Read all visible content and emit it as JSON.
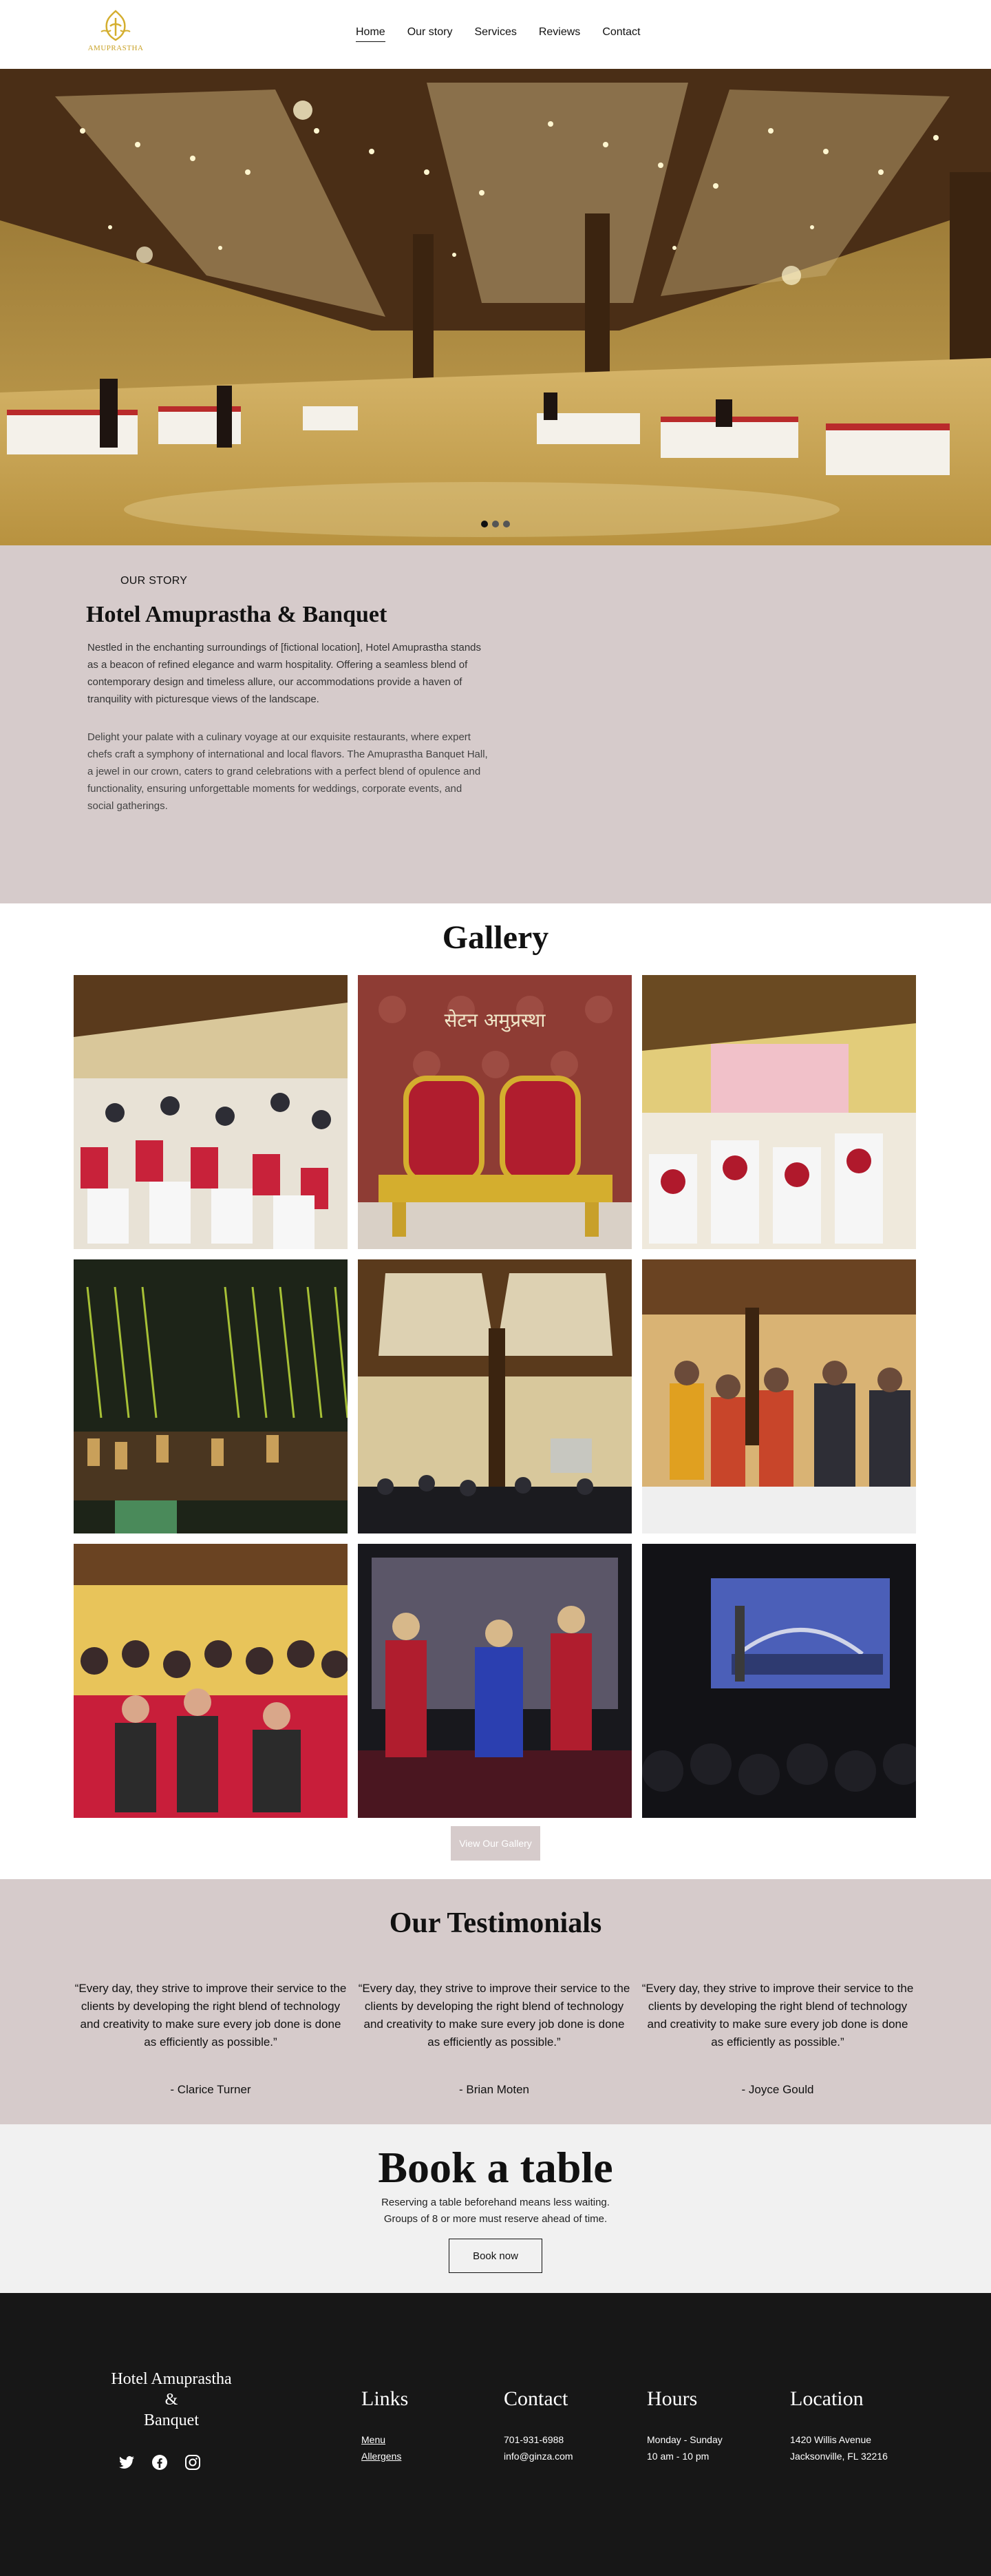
{
  "brand": {
    "logo_text": "AMUPRASTHA"
  },
  "nav": {
    "items": [
      {
        "label": "Home",
        "active": true
      },
      {
        "label": "Our story",
        "active": false
      },
      {
        "label": "Services",
        "active": false
      },
      {
        "label": "Reviews",
        "active": false
      },
      {
        "label": "Contact",
        "active": false
      }
    ]
  },
  "hero": {
    "slide_count": 3,
    "active_slide": 1
  },
  "story": {
    "label": "OUR STORY",
    "title": "Hotel Amuprastha & Banquet",
    "p1": "Nestled in the enchanting surroundings of [fictional location], Hotel Amuprastha stands as a beacon of refined elegance and warm hospitality. Offering a seamless blend of contemporary design and timeless allure, our accommodations provide a haven of tranquility with picturesque views of the landscape.",
    "p2": "Delight your palate with a culinary voyage at our exquisite restaurants, where expert chefs craft a symphony of international and local flavors. The Amuprastha Banquet Hall, a jewel in our crown, caters to grand celebrations with a perfect blend of opulence and functionality, ensuring unforgettable moments for weddings, corporate events, and social gatherings."
  },
  "gallery": {
    "title": "Gallery",
    "button": "View Our Gallery",
    "banner_text": "सेटन अमुप्रस्था"
  },
  "testimonials": {
    "title": "Our Testimonials",
    "items": [
      {
        "quote": "“Every day, they strive to improve their service to the clients by developing the right blend of technology and creativity to make sure every job done is done as efficiently as possible.”",
        "author": "- Clarice Turner"
      },
      {
        "quote": "“Every day, they strive to improve their service to the clients by developing the right blend of technology and creativity to make sure every job done is done as efficiently as possible.”",
        "author": "- Brian Moten"
      },
      {
        "quote": "“Every day, they strive to improve their service to the clients by developing the right blend of technology and creativity to make sure every job done is done as efficiently as possible.”",
        "author": "- Joyce Gould"
      }
    ]
  },
  "book": {
    "title": "Book a table",
    "line1": "Reserving a table beforehand means less waiting.",
    "line2": "Groups of 8 or more must reserve ahead of time.",
    "button": "Book now"
  },
  "footer": {
    "brand_line1": "Hotel Amuprastha",
    "brand_line2": "&",
    "brand_line3": "Banquet",
    "social": [
      "twitter-icon",
      "facebook-icon",
      "instagram-icon"
    ],
    "links": {
      "title": "Links",
      "menu": "Menu",
      "allergens": "Allergens"
    },
    "contact": {
      "title": "Contact",
      "phone": "701-931-6988",
      "email": "info@ginza.com"
    },
    "hours": {
      "title": "Hours",
      "days": "Monday - Sunday",
      "time": "10 am - 10 pm"
    },
    "location": {
      "title": "Location",
      "street": "1420 Willis Avenue",
      "city": "Jacksonville, FL 32216"
    }
  }
}
